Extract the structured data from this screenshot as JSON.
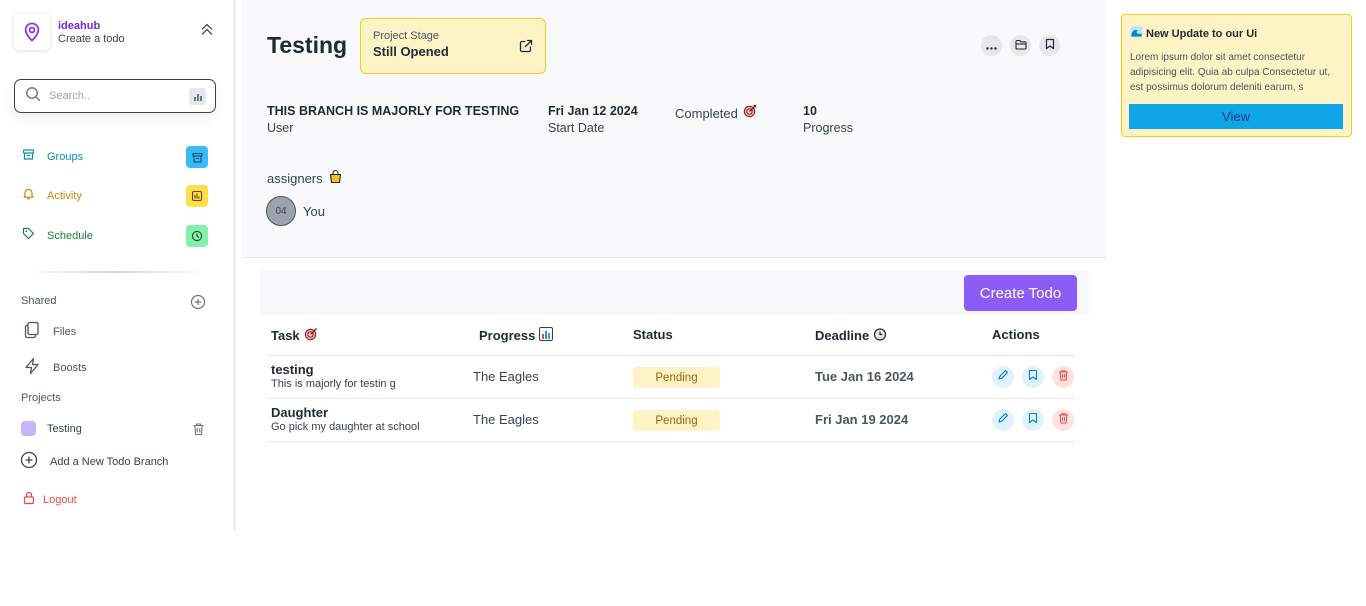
{
  "brand": {
    "name": "ideahub",
    "subtitle": "Create a todo",
    "icon": "map-pin-icon"
  },
  "search": {
    "placeholder": "Search..",
    "value": ""
  },
  "nav": [
    {
      "label": "Groups",
      "icon": "archive-icon",
      "color": "#0891b2",
      "badge_bg": "#38bdf8"
    },
    {
      "label": "Activity",
      "icon": "bell-icon",
      "color": "#ca8a04",
      "badge_bg": "#fde047"
    },
    {
      "label": "Schedule",
      "icon": "tag-icon",
      "color": "#15803d",
      "badge_bg": "#86efac"
    }
  ],
  "shared": {
    "label": "Shared",
    "items": [
      "Files",
      "Boosts"
    ]
  },
  "projects": {
    "label": "Projects",
    "items": [
      {
        "name": "Testing",
        "color": "#c4b5fd"
      }
    ],
    "add_label": "Add a New Todo Branch"
  },
  "logout_label": "Logout",
  "project": {
    "title": "Testing",
    "stage_label": "Project Stage",
    "stage_value": "Still Opened",
    "branch": {
      "value": "THIS BRANCH IS MAJORLY FOR TESTING",
      "label": "User"
    },
    "start": {
      "value": "Fri Jan 12 2024",
      "label": "Start Date"
    },
    "completed_label": "Completed",
    "progress": {
      "value": "10",
      "label": "Progress"
    },
    "assigners_label": "assigners",
    "assignee": {
      "initials": "04",
      "name": "You"
    }
  },
  "create_todo_label": "Create Todo",
  "table": {
    "headers": [
      "Task",
      "Progress",
      "Status",
      "Deadline",
      "Actions"
    ],
    "rows": [
      {
        "title": "testing",
        "desc": "This is majorly for testin g",
        "progress": "The Eagles",
        "status": "Pending",
        "deadline": "Tue Jan 16 2024"
      },
      {
        "title": "Daughter",
        "desc": "Go pick my daughter at school",
        "progress": "The Eagles",
        "status": "Pending",
        "deadline": "Fri Jan 19 2024"
      }
    ]
  },
  "update": {
    "title": "New Update to our Ui",
    "body": "Lorem ipsum dolor sit amet consectetur adipisicing elit. Quia ab culpa Consectetur ut, est possimus dolorum deleniti earum, s",
    "button": "View"
  },
  "colors": {
    "accent": "#8b5cf6",
    "stage_bg": "#fdf3c4",
    "logout": "#ef4444",
    "view_button": "#0ea5e9"
  }
}
